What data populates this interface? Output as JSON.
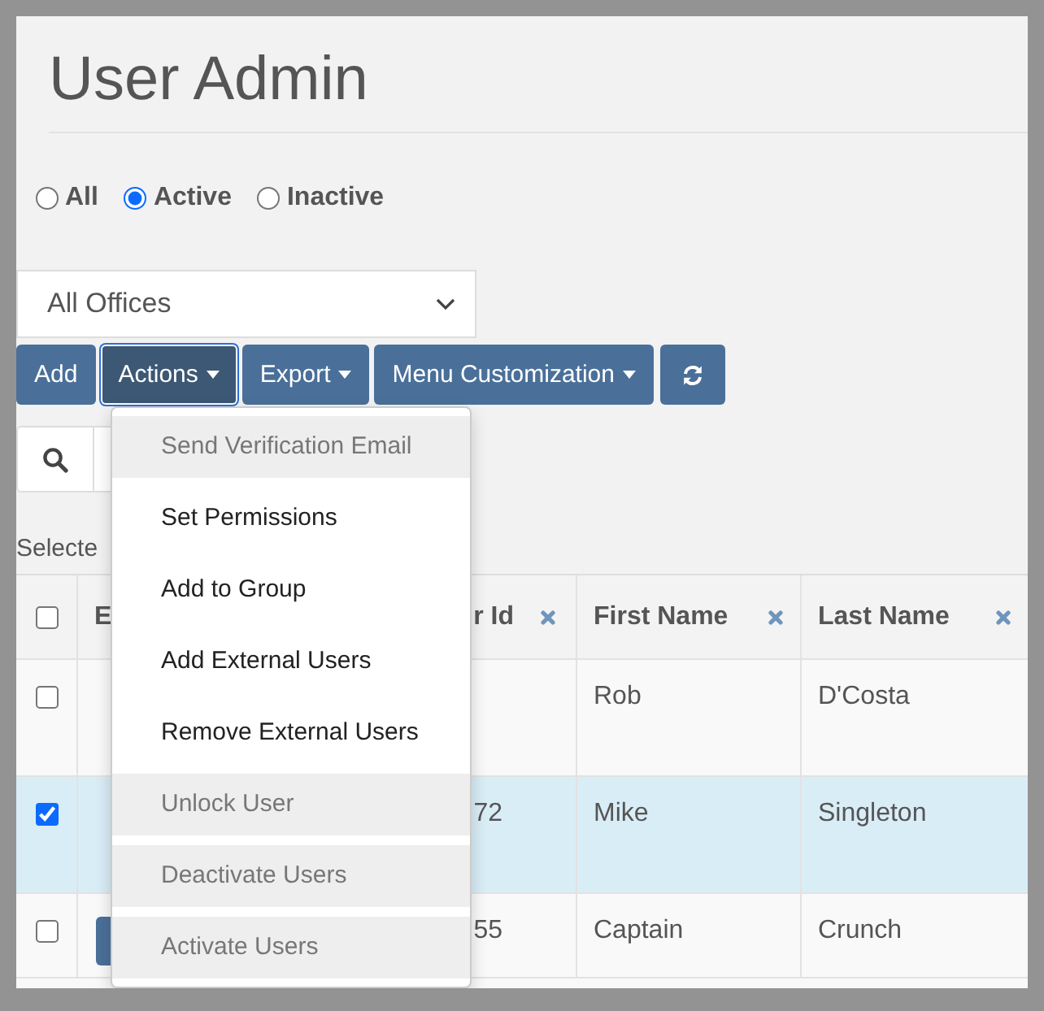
{
  "page": {
    "title": "User Admin"
  },
  "status_filter": [
    {
      "label": "All",
      "selected": false
    },
    {
      "label": "Active",
      "selected": true
    },
    {
      "label": "Inactive",
      "selected": false
    }
  ],
  "office_select": {
    "value": "All Offices"
  },
  "toolbar": [
    {
      "kind": "button",
      "label": "Add",
      "focused": false
    },
    {
      "kind": "dropdown",
      "label": "Actions",
      "focused": true
    },
    {
      "kind": "dropdown",
      "label": "Export",
      "focused": false
    },
    {
      "kind": "dropdown",
      "label": "Menu Customization",
      "focused": false
    },
    {
      "kind": "refresh",
      "focused": false
    }
  ],
  "selection_label": "Selecte",
  "actions_menu": [
    {
      "label": "Send Verification Email",
      "disabled": true
    },
    {
      "label": "Set Permissions",
      "disabled": false
    },
    {
      "label": "Add to Group",
      "disabled": false
    },
    {
      "label": "Add External Users",
      "disabled": false
    },
    {
      "label": "Remove External Users",
      "disabled": false
    },
    {
      "label": "Unlock User",
      "disabled": true
    },
    {
      "label": "Deactivate Users",
      "disabled": true
    },
    {
      "label": "Activate Users",
      "disabled": true
    }
  ],
  "table": {
    "select_all_checked": false,
    "columns": [
      {
        "label": "E"
      },
      {
        "label": "r Id",
        "removable": true
      },
      {
        "label": "First Name",
        "removable": true
      },
      {
        "label": "Last Name",
        "removable": true
      }
    ],
    "rows": [
      {
        "checked": false,
        "selected": false,
        "row_button": false,
        "first_name": "Rob",
        "last_name": "D'Costa"
      },
      {
        "checked": true,
        "selected": true,
        "row_button": false,
        "column_3": "72",
        "first_name": "Mike",
        "last_name": "Singleton"
      },
      {
        "checked": false,
        "selected": false,
        "row_button": true,
        "column_3": "55",
        "first_name": "Captain",
        "last_name": "Crunch"
      }
    ]
  }
}
